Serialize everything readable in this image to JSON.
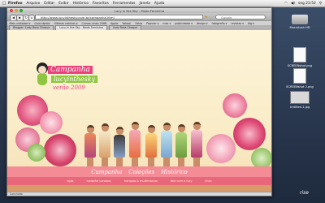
{
  "menubar": {
    "app_name": "Firefox",
    "items": [
      "Arquivo",
      "Editar",
      "Exibir",
      "Histórico",
      "Favoritos",
      "Ferramentas",
      "Janela",
      "Ajuda"
    ],
    "clock": "seg 23:52"
  },
  "browser": {
    "window_title": "Lucy in the Sky - Moda Feminina",
    "url": "http://www.lucyinthesky.com.br/campanha.html",
    "search_placeholder": "Google",
    "bookmarks": [
      "Mais visitados ▾",
      "Guia rápido",
      "Últimas notícias ▾",
      "Cursos cinev 2008",
      "Apple",
      "Yahoo!",
      "Fotos",
      "Popular ▾",
      "mac ▾",
      "publicidade ▾",
      "design ▾",
      "fotografia ▾",
      "revistas ▾",
      "dig ▾"
    ],
    "tabs": [
      {
        "label": "Blogger: Lady Rosa Choque",
        "active": false
      },
      {
        "label": "Lucy in the Sky - Moda Feminina",
        "active": true
      },
      {
        "label": "Lady Rosa Choque",
        "active": false
      }
    ],
    "status": "Concluído"
  },
  "page": {
    "campaign_line1": "Campanha",
    "campaign_line2": "lucyinthesky",
    "campaign_line3": "verão 2009",
    "nav": [
      "Campanha",
      "Coleções",
      "Histórico"
    ],
    "footer_links": [
      "lojas",
      "trabalhe conosco",
      "franquia & multimarcas",
      "fale com a lucy",
      "links"
    ]
  },
  "desktop": {
    "icons": [
      {
        "label": "Macintosh HD",
        "kind": "hd-icon"
      },
      {
        "label": "SCREENshot.png",
        "kind": "image-file-icon"
      },
      {
        "label": "SCREENshot 2.png",
        "kind": "image-file-icon"
      },
      {
        "label": "Untitled-1.jpg",
        "kind": "image-file-icon"
      }
    ],
    "dock_logo": "rise"
  },
  "colors": {
    "pink": "#e8437a",
    "green": "#8ec63f",
    "nav_pink": "#f48c95",
    "page_bg": "#fdf4d9"
  }
}
